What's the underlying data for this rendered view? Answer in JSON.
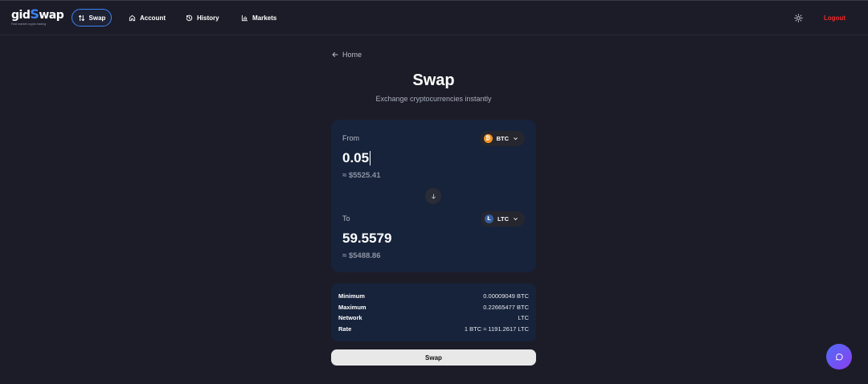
{
  "brand": {
    "logo_prefix": "gid",
    "logo_s": "S",
    "logo_suffix": "wap",
    "tagline": "Fast market crypto trading"
  },
  "nav": {
    "swap": "Swap",
    "account": "Account",
    "history": "History",
    "markets": "Markets",
    "logout": "Logout"
  },
  "page": {
    "back_label": "Home",
    "title": "Swap",
    "subtitle": "Exchange cryptocurrencies instantly"
  },
  "from": {
    "label": "From",
    "token": "BTC",
    "amount": "0.05",
    "usd": "≈ $5525.41"
  },
  "to": {
    "label": "To",
    "token": "LTC",
    "amount": "59.5579",
    "usd": "≈ $5488.86"
  },
  "info": {
    "minimum_label": "Minimum",
    "minimum_value": "0.00009049 BTC",
    "maximum_label": "Maximum",
    "maximum_value": "0.22665477 BTC",
    "network_label": "Network",
    "network_value": "LTC",
    "rate_label": "Rate",
    "rate_value": "1 BTC ≈ 1191.2617 LTC"
  },
  "actions": {
    "swap_button": "Swap"
  },
  "colors": {
    "background": "#1c1c28",
    "card": "#16233b",
    "accent": "#3b82f6",
    "logout": "#ef2b2b",
    "btc": "#f39321",
    "ltc": "#345d9d"
  },
  "icons": {
    "swap_nav": "arrows-up-down-icon",
    "account_nav": "home-icon",
    "history_nav": "history-icon",
    "markets_nav": "bar-chart-icon",
    "theme": "sun-icon",
    "back": "arrow-left-icon",
    "switch": "arrow-down-icon",
    "chat": "chat-icon"
  }
}
